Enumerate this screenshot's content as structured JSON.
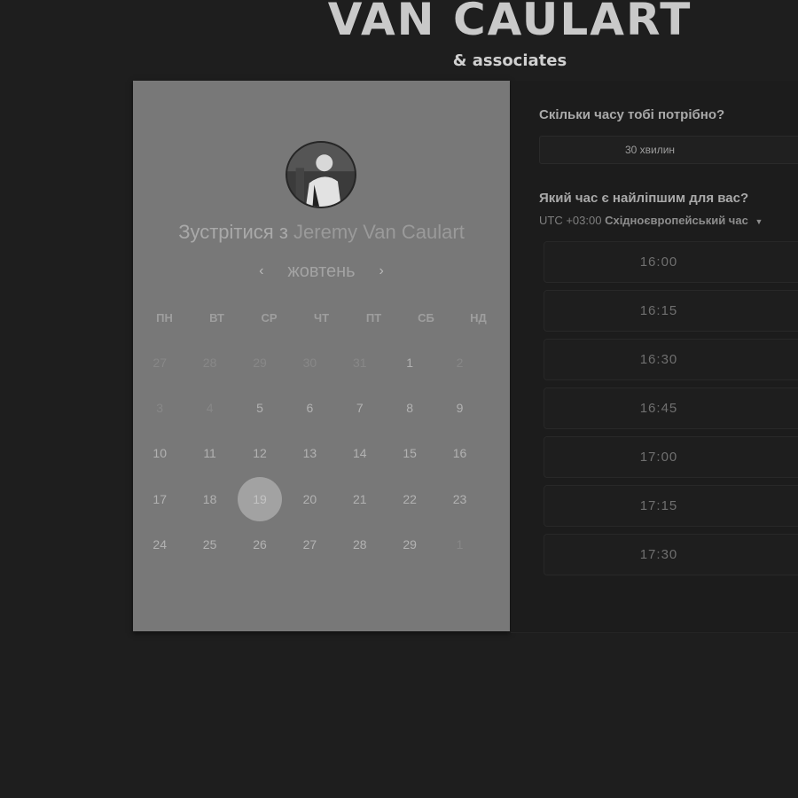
{
  "brand": {
    "name": "VAN CAULART",
    "subtitle": "& associates"
  },
  "calendar": {
    "meet_prefix": "Зустрітися з",
    "host_name": "Jeremy Van Caulart",
    "month": "жовтень",
    "weekdays": [
      "ПН",
      "ВТ",
      "СР",
      "ЧТ",
      "ПТ",
      "СБ",
      "НД"
    ],
    "days": [
      {
        "label": "27",
        "state": "muted"
      },
      {
        "label": "28",
        "state": "muted"
      },
      {
        "label": "29",
        "state": "muted"
      },
      {
        "label": "30",
        "state": "muted"
      },
      {
        "label": "31",
        "state": "muted"
      },
      {
        "label": "1",
        "state": "active"
      },
      {
        "label": "2",
        "state": "muted"
      },
      {
        "label": "3",
        "state": "muted"
      },
      {
        "label": "4",
        "state": "muted"
      },
      {
        "label": "5",
        "state": "active"
      },
      {
        "label": "6",
        "state": "active"
      },
      {
        "label": "7",
        "state": "active"
      },
      {
        "label": "8",
        "state": "active"
      },
      {
        "label": "9",
        "state": "active"
      },
      {
        "label": "10",
        "state": "active"
      },
      {
        "label": "11",
        "state": "active"
      },
      {
        "label": "12",
        "state": "active"
      },
      {
        "label": "13",
        "state": "active"
      },
      {
        "label": "14",
        "state": "active"
      },
      {
        "label": "15",
        "state": "active"
      },
      {
        "label": "16",
        "state": "active"
      },
      {
        "label": "17",
        "state": "active"
      },
      {
        "label": "18",
        "state": "active"
      },
      {
        "label": "19",
        "state": "selected"
      },
      {
        "label": "20",
        "state": "active"
      },
      {
        "label": "21",
        "state": "active"
      },
      {
        "label": "22",
        "state": "active"
      },
      {
        "label": "23",
        "state": "active"
      },
      {
        "label": "24",
        "state": "active"
      },
      {
        "label": "25",
        "state": "active"
      },
      {
        "label": "26",
        "state": "active"
      },
      {
        "label": "27",
        "state": "active"
      },
      {
        "label": "28",
        "state": "active"
      },
      {
        "label": "29",
        "state": "active"
      },
      {
        "label": "1",
        "state": "muted"
      }
    ]
  },
  "scheduler": {
    "duration_question": "Скільки часу тобі потрібно?",
    "duration_value": "30 хвилин",
    "time_question": "Який час є найліпшим для вас?",
    "timezone_offset": "UTC +03:00",
    "timezone_name": "Східноєвропейський час",
    "slots": [
      "16:00",
      "16:15",
      "16:30",
      "16:45",
      "17:00",
      "17:15",
      "17:30"
    ]
  },
  "icons": {
    "prev": "chevron-left-icon",
    "next": "chevron-right-icon",
    "timezone_caret": "caret-down-icon"
  },
  "colors": {
    "background": "#1e1e1e",
    "card": "#787878",
    "selected_day": "#a2a2a2"
  }
}
